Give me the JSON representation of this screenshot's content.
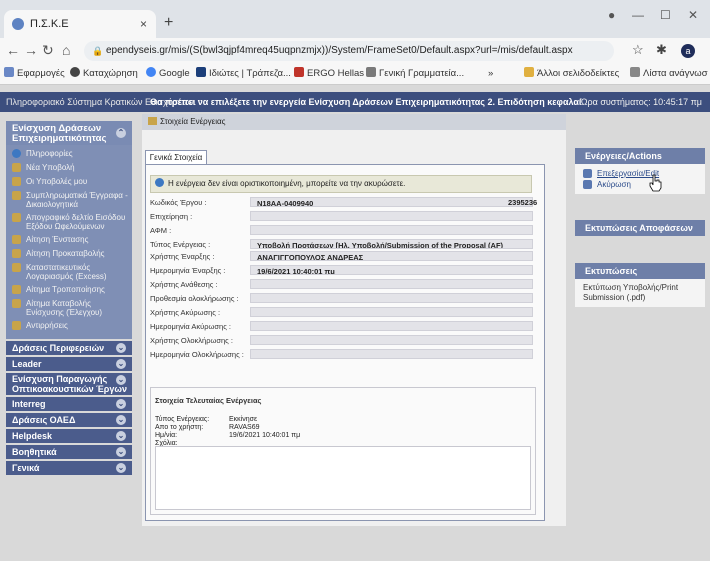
{
  "browser": {
    "tab_title": "Π.Σ.Κ.Ε",
    "tab_close": "×",
    "new_tab": "+",
    "url": "ependyseis.gr/mis/(S(bwl3qjpf4mreq45uqpnzmjx))/System/FrameSet0/Default.aspx?url=/mis/default.aspx",
    "avatar_letter": "a"
  },
  "bookmarks": {
    "items": [
      "Εφαρμογές",
      "Καταχώρηση",
      "Google",
      "Ιδιώτες | Τράπεζα...",
      "ERGO Hellas",
      "Γενική Γραμματεία..."
    ],
    "more": "»",
    "other": "Άλλοι σελιδοδείκτες",
    "reading_list": "Λίστα ανάγνωσ"
  },
  "header": {
    "system": "Πληροφοριακό Σύστημα Κρατικών Ενισχύσεων. :",
    "message": "Θα πρέπει να επιλέξετε την ενεργεία Ενίσχυση Δράσεων Επιχειρηματικότητας 2. Επιδότηση κεφαλαί",
    "time_label": "Ώρα συστήματος: 10:45:17 πμ"
  },
  "sidebar": {
    "title": "Ενίσχυση Δράσεων Επιχειρηματικότητας",
    "items": [
      "Πληροφορίες",
      "Νέα Υποβολή",
      "Οι Υποβολές μου",
      "Συμπληρωματικά Έγγραφα - Δικαιολογητικά",
      "Απογραφικό δελτίο Εισόδου Εξόδου Ωφελούμενων",
      "Αίτηση Ένστασης",
      "Αίτηση Προκαταβολής",
      "Καταστατικευτικός Λογαριασμός (Excess)",
      "Αίτημα Τροποποίησης",
      "Αίτημα Καταβολής Ενίσχυσης (Έλεγχου)",
      "Αντιρρήσεις"
    ],
    "sections": [
      "Δράσεις Περιφερειών",
      "Leader",
      "Ενίσχυση Παραγωγής Οπτικοακουστικών Έργων",
      "Interreg",
      "Δράσεις ΟΑΕΔ",
      "Helpdesk",
      "Βοηθητικά",
      "Γενικά"
    ]
  },
  "main": {
    "breadcrumb": "Στοιχεία Ενέργειας",
    "tab_label": "Γενικά Στοιχεία",
    "notice": "Η ενέργεια δεν είναι οριστικοποιημένη, μπορείτε να την ακυρώσετε.",
    "fields": [
      {
        "label": "Κωδικός Έργου :",
        "value": "N18AA-0409940",
        "extra": "2395236"
      },
      {
        "label": "Επιχείρηση :",
        "value": ""
      },
      {
        "label": "ΑΦΜ :",
        "value": ""
      },
      {
        "label": "Τύπος Ενέργειας :",
        "value": "Υποβολή Προτάσεων [Ηλ. Υποβολή/Submission of the Proposal (AF)"
      },
      {
        "label": "Χρήστης Έναρξης :",
        "value": "ΑΝΑΓΙΓΓΟΠΟΥΛΟΣ ΑΝΔΡΕΑΣ"
      },
      {
        "label": "Ημερομηνία Έναρξης :",
        "value": "19/6/2021 10:40:01 πμ"
      },
      {
        "label": "Χρήστης Ανάθεσης :",
        "value": ""
      },
      {
        "label": "Προθεσμία ολοκλήρωσης :",
        "value": ""
      },
      {
        "label": "Χρήστης Ακύρωσης :",
        "value": ""
      },
      {
        "label": "Ημερομηνία Ακύρωσης :",
        "value": ""
      },
      {
        "label": "Χρήστης Ολοκλήρωσης :",
        "value": ""
      },
      {
        "label": "Ημερομηνία Ολοκλήρωσης :",
        "value": ""
      }
    ],
    "last_action": {
      "title": "Στοιχεία Τελευταίας Ενέργειας",
      "rows": [
        {
          "label": "Τύπος Ενέργειας:",
          "value": "Εκκίνησε"
        },
        {
          "label": "Απο το χρήστη:",
          "value": "RAVAS69"
        },
        {
          "label": "Ημ/νία:",
          "value": "19/6/2021 10:40:01 πμ"
        },
        {
          "label": "Σχόλια:",
          "value": ""
        }
      ]
    }
  },
  "right": {
    "actions_title": "Ενέργειες/Actions",
    "edit": "Επεξεργασία/Edit",
    "cancel": "Ακύρωση",
    "decisions_title": "Εκτυπώσεις Αποφάσεων",
    "prints_title": "Εκτυπώσεις",
    "print_item": "Εκτύπωση Υποβολής/Print Submission (.pdf)"
  }
}
